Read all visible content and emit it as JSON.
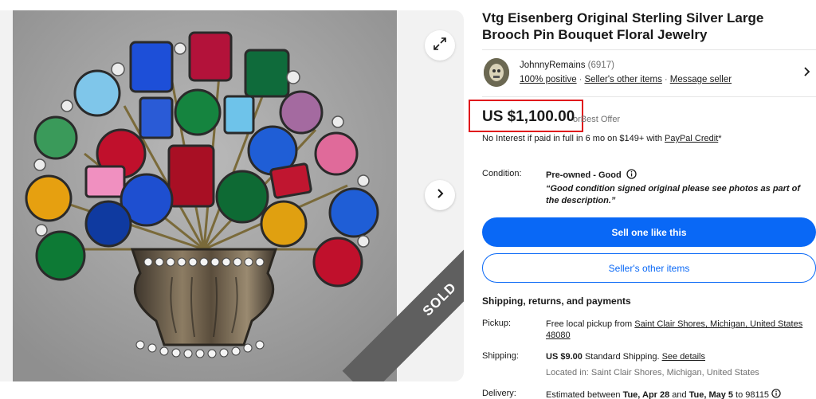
{
  "listing": {
    "title": "Vtg Eisenberg Original Sterling Silver Large Brooch Pin Bouquet Floral Jewelry",
    "sold_label": "SOLD"
  },
  "seller": {
    "name": "JohnnyRemains",
    "feedback_count": "(6917)",
    "positive": "100% positive",
    "other_items_link": "Seller's other items",
    "message_link": "Message seller"
  },
  "price": {
    "amount": "US $1,100.00",
    "best_offer_prefix": "or",
    "best_offer": "Best Offer",
    "financing_text": "No Interest if paid in full in 6 mo on $149+ with",
    "financing_link": "PayPal Credit",
    "financing_suffix": "*"
  },
  "condition": {
    "label": "Condition:",
    "value": "Pre-owned - Good",
    "quote": "“Good condition signed original please see photos as part of the description.”"
  },
  "actions": {
    "primary": "Sell one like this",
    "secondary": "Seller's other items"
  },
  "shipping": {
    "heading": "Shipping, returns, and payments",
    "pickup_label": "Pickup:",
    "pickup_text": "Free local pickup from",
    "pickup_location": "Saint Clair Shores, Michigan, United States 48080",
    "shipping_label": "Shipping:",
    "shipping_cost": "US $9.00",
    "shipping_method": "Standard Shipping.",
    "shipping_details": "See details",
    "located_in": "Located in: Saint Clair Shores, Michigan, United States",
    "delivery_label": "Delivery:",
    "delivery_prefix": "Estimated between",
    "delivery_start": "Tue, Apr 28",
    "delivery_and": "and",
    "delivery_end": "Tue, May 5",
    "delivery_zip": "to 98115"
  },
  "icons": {
    "expand": "expand-icon",
    "next": "chevron-right-icon",
    "info": "info-icon",
    "seller_chevron": "chevron-right-icon"
  },
  "colors": {
    "primary_button": "#0968f6",
    "price_highlight_border": "#e0181c",
    "sold_ribbon": "#5f5f5f"
  }
}
